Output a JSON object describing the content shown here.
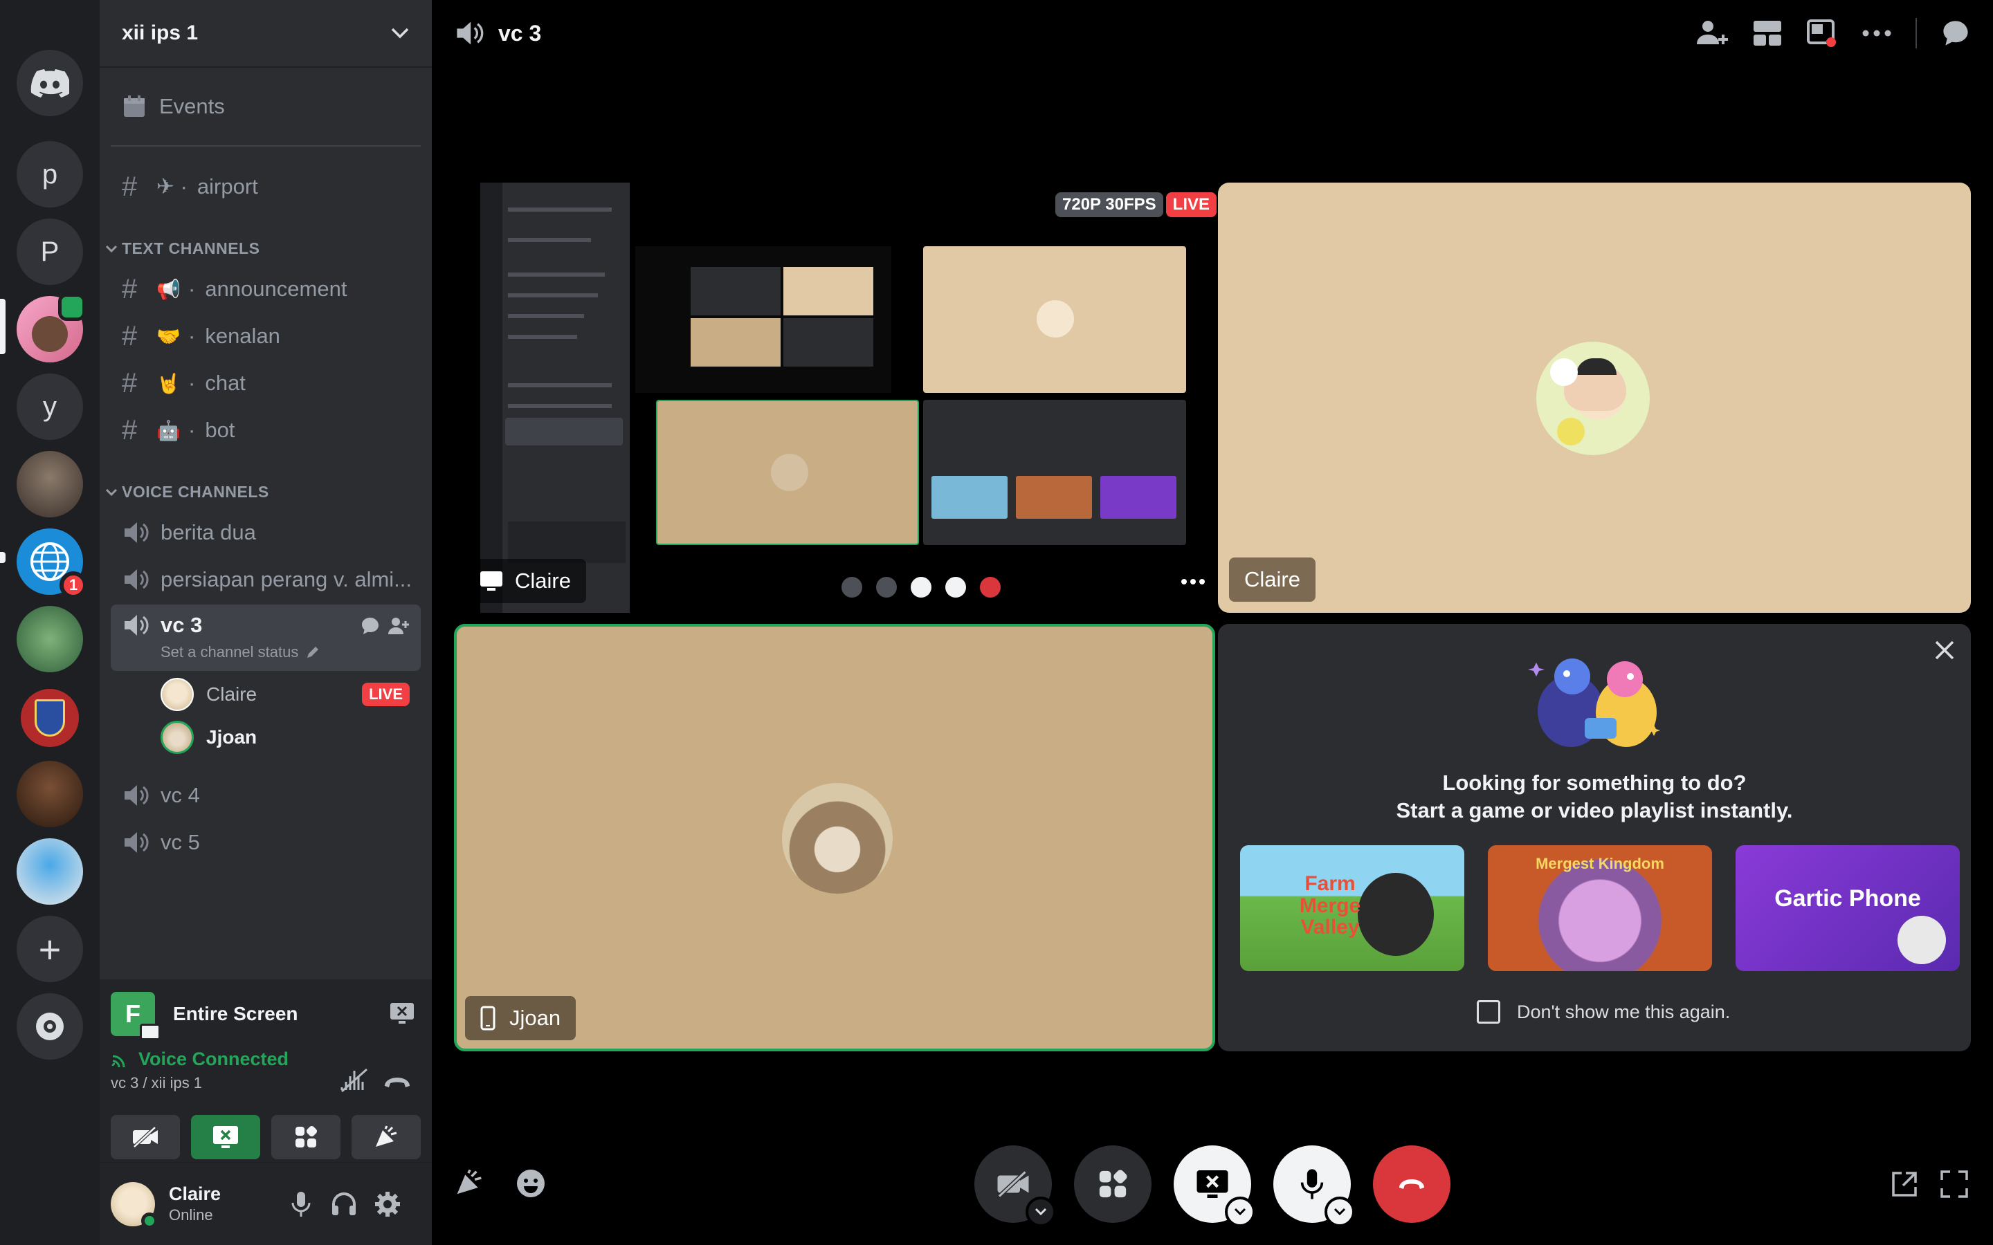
{
  "server": {
    "name": "xii ips 1",
    "events_label": "Events",
    "airport_channel": "airport",
    "text_category": "TEXT CHANNELS",
    "voice_category": "VOICE CHANNELS",
    "text_channels": [
      {
        "emoji": "📢",
        "name": "announcement"
      },
      {
        "emoji": "🤝",
        "name": "kenalan"
      },
      {
        "emoji": "🤘",
        "name": "chat"
      },
      {
        "emoji": "🤖",
        "name": "bot"
      }
    ],
    "voice_channels": {
      "berita": "berita dua",
      "persiapan": "persiapan perang v. almi...",
      "vc3": "vc 3",
      "vc3_status": "Set a channel status",
      "vc4": "vc 4",
      "vc5": "vc 5"
    },
    "members": [
      {
        "name": "Claire",
        "live": "LIVE"
      },
      {
        "name": "Jjoan"
      }
    ]
  },
  "rail": {
    "letters": [
      "p",
      "P",
      "y"
    ],
    "notification_count": "1",
    "add_label": "+"
  },
  "share": {
    "title": "Entire Screen",
    "icon_letter": "F",
    "voice_connected": "Voice Connected",
    "voice_location": "vc 3 / xii ips 1"
  },
  "user": {
    "name": "Claire",
    "status": "Online"
  },
  "call": {
    "channel": "vc 3",
    "stream_quality": "720P 30FPS",
    "live_label": "LIVE",
    "stream_owner": "Claire",
    "claire_tile_label": "Claire",
    "jjoan_tile_label": "Jjoan"
  },
  "activity": {
    "headline": "Looking for something to do?",
    "subline": "Start a game or video playlist instantly.",
    "games": [
      "Farm Merge Valley",
      "Mergest Kingdom",
      "Gartic Phone"
    ],
    "dont_show": "Don't show me this again."
  },
  "colors": {
    "accent_green": "#23a55a",
    "live_red": "#f23f43",
    "tan": "#e0c9a4",
    "tan_dark": "#c9ad84"
  }
}
